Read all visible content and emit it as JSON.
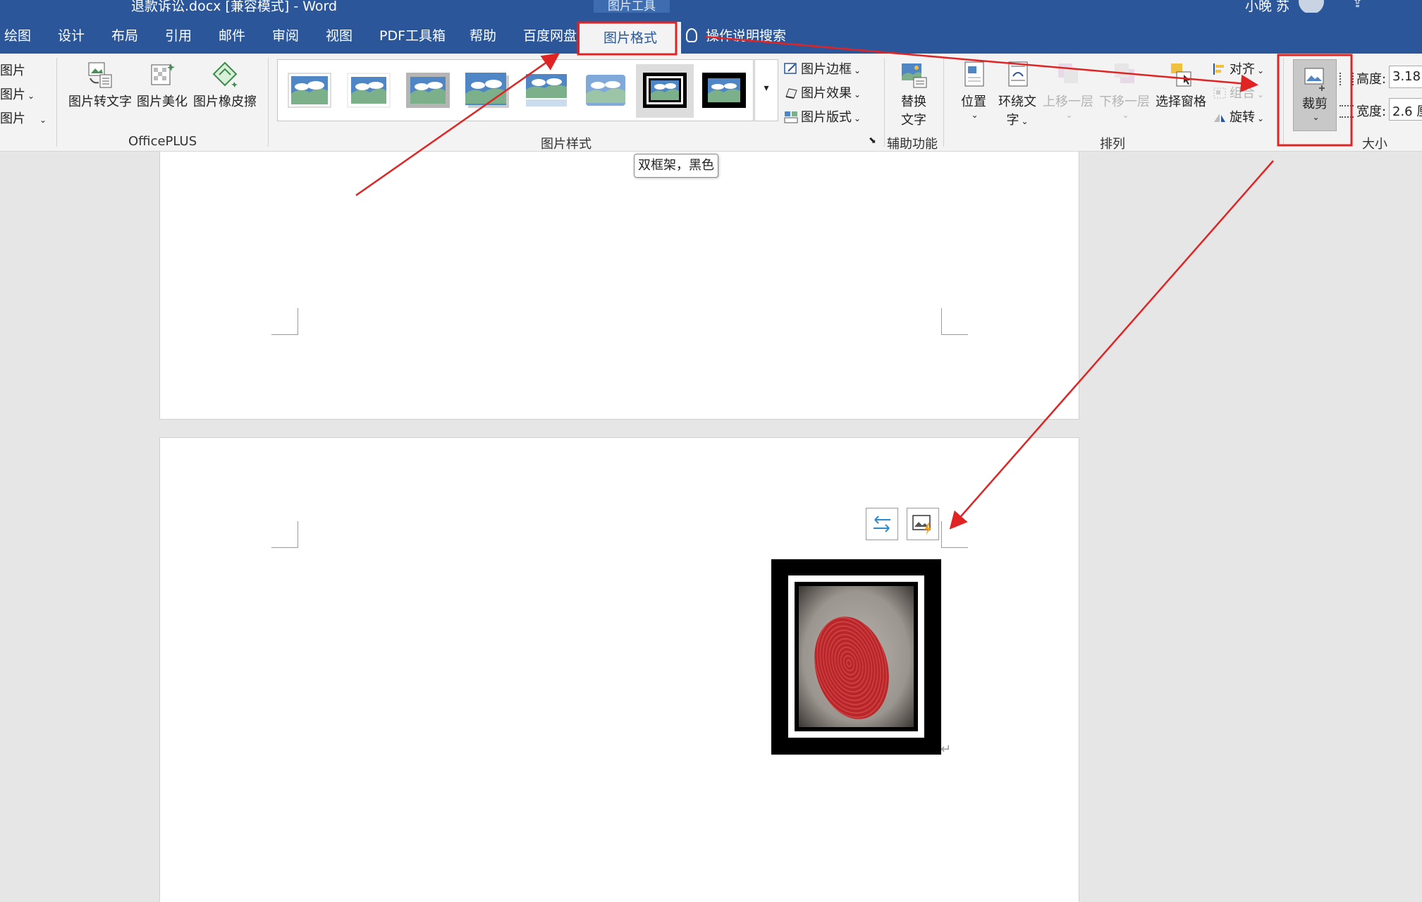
{
  "titlebar": {
    "document_title": "退款诉讼.docx [兼容模式]  -  Word",
    "contextual_tools": "图片工具",
    "user_name": "小晚 苏",
    "share_icon": "share-icon"
  },
  "tabs": [
    {
      "label": "绘图"
    },
    {
      "label": "设计"
    },
    {
      "label": "布局"
    },
    {
      "label": "引用"
    },
    {
      "label": "邮件"
    },
    {
      "label": "审阅"
    },
    {
      "label": "视图"
    },
    {
      "label": "PDF工具箱"
    },
    {
      "label": "帮助"
    },
    {
      "label": "百度网盘"
    },
    {
      "label": "图片格式"
    }
  ],
  "tell_me": "操作说明搜索",
  "ribbon": {
    "left_partial": [
      "图片",
      "图片",
      "图片"
    ],
    "officeplus": {
      "label": "OfficePLUS",
      "buttons": [
        "图片转文字",
        "图片美化",
        "图片橡皮擦"
      ]
    },
    "picture_styles": {
      "label": "图片样式",
      "commands": [
        "图片边框",
        "图片效果",
        "图片版式"
      ]
    },
    "accessibility": {
      "label": "辅助功能",
      "alt_text_line1": "替换",
      "alt_text_line2": "文字"
    },
    "arrange": {
      "label": "排列",
      "position": "位置",
      "wrap_line1": "环绕文",
      "wrap_line2": "字",
      "bring_forward": "上移一层",
      "send_backward": "下移一层",
      "selection_pane": "选择窗格",
      "align": "对齐",
      "group": "组合",
      "rotate": "旋转"
    },
    "size": {
      "label": "大小",
      "crop": "裁剪",
      "height_label": "高度:",
      "height_value": "3.18",
      "width_label": "宽度:",
      "width_value": "2.6 厘"
    }
  },
  "tooltip": "双框架，黑色",
  "colors": {
    "ribbon_blue": "#2b579a",
    "annotation_red": "#e02424",
    "canvas": "#e6e6e6"
  }
}
